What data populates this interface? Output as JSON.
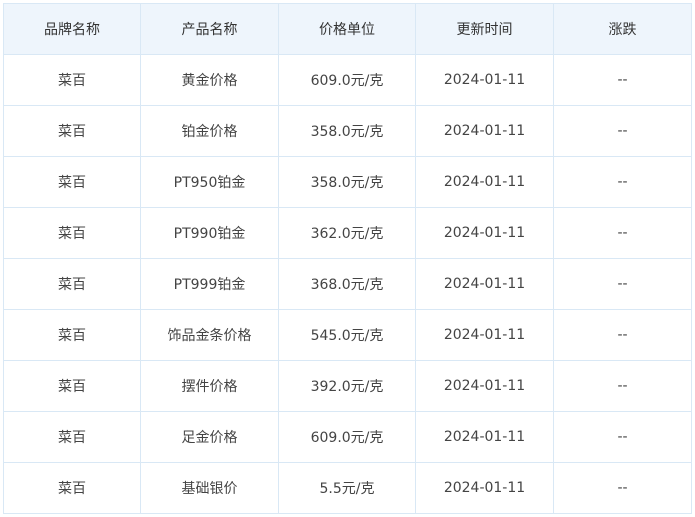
{
  "table": {
    "headers": [
      "品牌名称",
      "产品名称",
      "价格单位",
      "更新时间",
      "涨跌"
    ],
    "rows": [
      [
        "菜百",
        "黄金价格",
        "609.0元/克",
        "2024-01-11",
        "--"
      ],
      [
        "菜百",
        "铂金价格",
        "358.0元/克",
        "2024-01-11",
        "--"
      ],
      [
        "菜百",
        "PT950铂金",
        "358.0元/克",
        "2024-01-11",
        "--"
      ],
      [
        "菜百",
        "PT990铂金",
        "362.0元/克",
        "2024-01-11",
        "--"
      ],
      [
        "菜百",
        "PT999铂金",
        "368.0元/克",
        "2024-01-11",
        "--"
      ],
      [
        "菜百",
        "饰品金条价格",
        "545.0元/克",
        "2024-01-11",
        "--"
      ],
      [
        "菜百",
        "摆件价格",
        "392.0元/克",
        "2024-01-11",
        "--"
      ],
      [
        "菜百",
        "足金价格",
        "609.0元/克",
        "2024-01-11",
        "--"
      ],
      [
        "菜百",
        "基础银价",
        "5.5元/克",
        "2024-01-11",
        "--"
      ]
    ]
  },
  "colors": {
    "header_background": "#eef5fc",
    "border": "#d9e8f5",
    "text": "#333333"
  }
}
